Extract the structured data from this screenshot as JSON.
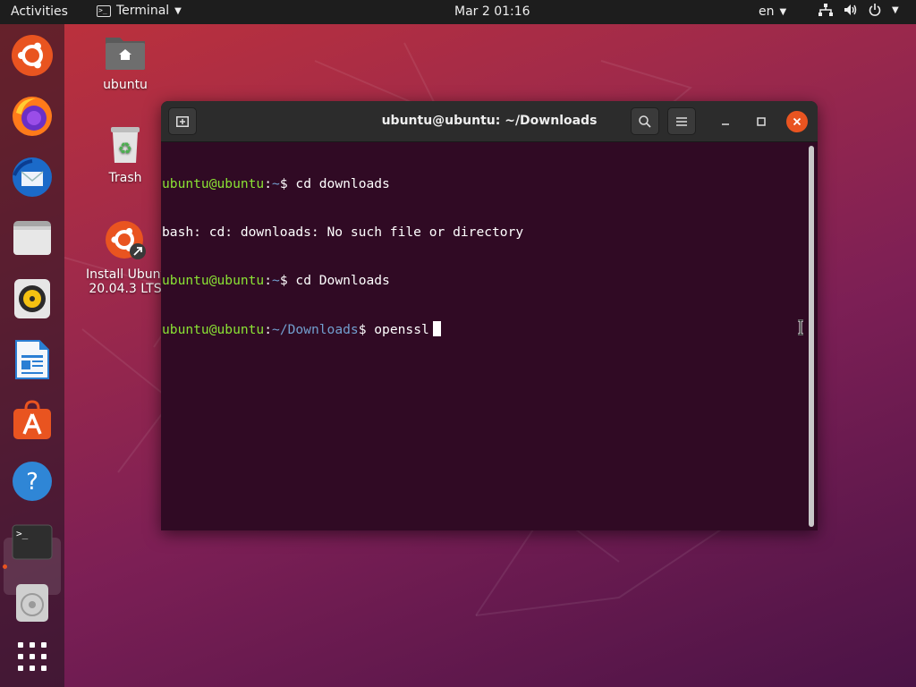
{
  "topbar": {
    "activities": "Activities",
    "app_name": "Terminal",
    "clock": "Mar 2  01:16",
    "language": "en"
  },
  "dock": {
    "items": [
      "ubuntu-software-logo",
      "firefox",
      "thunderbird",
      "files",
      "rhythmbox",
      "libreoffice-writer",
      "ubuntu-software",
      "help",
      "terminal",
      "optical-drive",
      "show-applications"
    ],
    "active": "terminal"
  },
  "desktop": {
    "home_label": "ubuntu",
    "trash_label": "Trash",
    "installer_label_line1": "Install Ubuntu",
    "installer_label_line2": "20.04.3 LTS"
  },
  "window": {
    "title": "ubuntu@ubuntu: ~/Downloads"
  },
  "terminal": {
    "line1_user": "ubuntu@ubuntu",
    "line1_path": "~",
    "line1_cmd": "cd downloads",
    "line2": "bash: cd: downloads: No such file or directory",
    "line3_user": "ubuntu@ubuntu",
    "line3_path": "~",
    "line3_cmd": "cd Downloads",
    "line4_user": "ubuntu@ubuntu",
    "line4_path": "~/Downloads",
    "line4_cmd": "openssl"
  },
  "colors": {
    "terminal_bg": "#300a24",
    "prompt_user": "#8ae234",
    "prompt_path": "#729fcf",
    "accent": "#e95420"
  }
}
